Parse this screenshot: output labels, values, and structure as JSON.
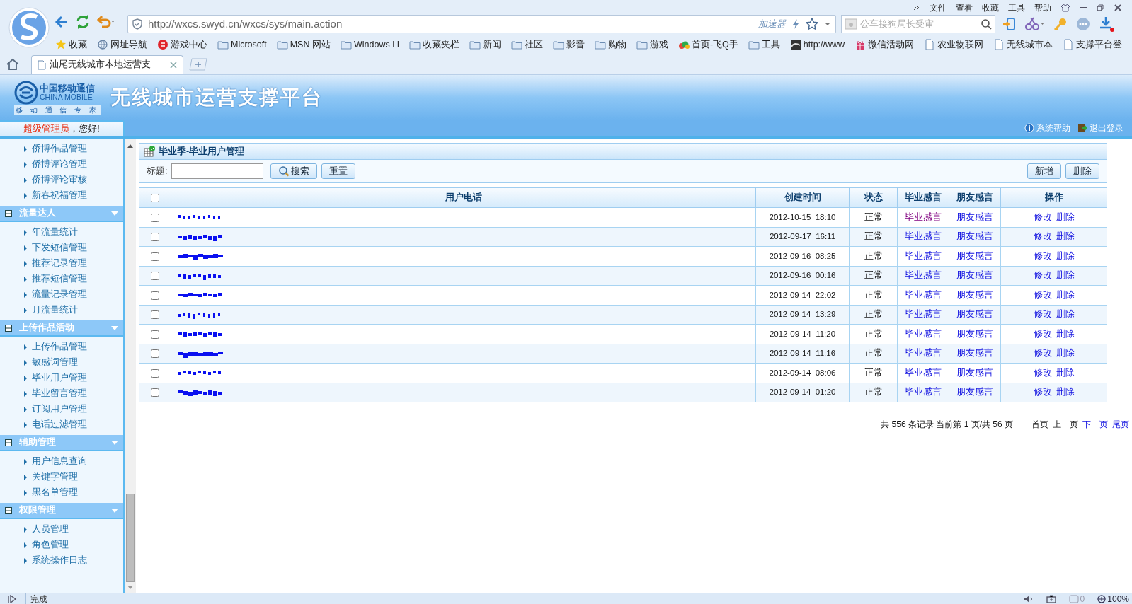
{
  "browser": {
    "menu": [
      "文件",
      "查看",
      "收藏",
      "工具",
      "帮助"
    ],
    "address": "http://wxcs.swyd.cn/wxcs/sys/main.action",
    "accelerator": "加速器",
    "search_placeholder": "公车接狗局长受审",
    "bookmarks": [
      {
        "label": "收藏",
        "kind": "star"
      },
      {
        "label": "网址导航",
        "kind": "globe"
      },
      {
        "label": "游戏中心",
        "kind": "game"
      },
      {
        "label": "Microsoft",
        "kind": "folder"
      },
      {
        "label": "MSN 网站",
        "kind": "folder"
      },
      {
        "label": "Windows Li",
        "kind": "folder"
      },
      {
        "label": "收藏夹栏",
        "kind": "folder"
      },
      {
        "label": "新闻",
        "kind": "folder"
      },
      {
        "label": "社区",
        "kind": "folder"
      },
      {
        "label": "影音",
        "kind": "folder"
      },
      {
        "label": "购物",
        "kind": "folder"
      },
      {
        "label": "游戏",
        "kind": "folder"
      },
      {
        "label": "首页-飞Q手",
        "kind": "cloud"
      },
      {
        "label": "工具",
        "kind": "folder"
      },
      {
        "label": "http://www",
        "kind": "image"
      },
      {
        "label": "微信活动网",
        "kind": "gift"
      },
      {
        "label": "农业物联网",
        "kind": "page"
      },
      {
        "label": "无线城市本",
        "kind": "page"
      },
      {
        "label": "支撑平台登",
        "kind": "page"
      }
    ],
    "tabs": [
      {
        "title": "汕尾无线城市本地运营支",
        "selected": true
      }
    ],
    "status": "完成",
    "ad_count": "0",
    "zoom": "100%"
  },
  "header": {
    "logo_cn": "中国移动通信",
    "logo_en": "CHINA MOBILE",
    "logo_tagline": "移 动 通 信 专 家",
    "title": "无线城市运营支撑平台",
    "links": [
      {
        "label": "系统帮助",
        "kind": "help"
      },
      {
        "label": "退出登录",
        "kind": "exit"
      }
    ]
  },
  "sidebar": {
    "user": "超级管理员",
    "greeting": "，您好!",
    "groups": [
      {
        "items": [
          "侨博作品管理",
          "侨博评论管理",
          "侨博评论审核",
          "新春祝福管理"
        ]
      },
      {
        "title": "流量达人",
        "expanded": true,
        "items": [
          "年流量统计",
          "下发短信管理",
          "推荐记录管理",
          "推荐短信管理",
          "流量记录管理",
          "月流量统计"
        ]
      },
      {
        "title": "上传作品活动",
        "expanded": true,
        "items": [
          "上传作品管理",
          "敏感词管理",
          "毕业用户管理",
          "毕业留言管理",
          "订阅用户管理",
          "电话过滤管理"
        ]
      },
      {
        "title": "辅助管理",
        "expanded": true,
        "items": [
          "用户信息查询",
          "关键字管理",
          "黑名单管理"
        ]
      },
      {
        "title": "权限管理",
        "expanded": true,
        "items": [
          "人员管理",
          "角色管理",
          "系统操作日志"
        ]
      }
    ]
  },
  "panel": {
    "title": "毕业季-毕业用户管理",
    "search_label": "标题:",
    "search_button": "搜索",
    "reset_button": "重置",
    "add_button": "新增",
    "delete_button": "删除"
  },
  "table": {
    "select_all_checked": false,
    "columns": [
      "用户电话",
      "创建时间",
      "状态",
      "毕业感言",
      "朋友感言",
      "操作"
    ],
    "rows": [
      {
        "checked": false,
        "created": "2012-10-15  18:10",
        "status": "正常",
        "grad": "毕业感言",
        "grad_visited": true,
        "friend": "朋友感言",
        "edit": "修改",
        "delete": "删除"
      },
      {
        "checked": false,
        "created": "2012-09-17  16:11",
        "status": "正常",
        "grad": "毕业感言",
        "grad_visited": false,
        "friend": "朋友感言",
        "edit": "修改",
        "delete": "删除"
      },
      {
        "checked": false,
        "created": "2012-09-16  08:25",
        "status": "正常",
        "grad": "毕业感言",
        "grad_visited": false,
        "friend": "朋友感言",
        "edit": "修改",
        "delete": "删除"
      },
      {
        "checked": false,
        "created": "2012-09-16  00:16",
        "status": "正常",
        "grad": "毕业感言",
        "grad_visited": false,
        "friend": "朋友感言",
        "edit": "修改",
        "delete": "删除"
      },
      {
        "checked": false,
        "created": "2012-09-14  22:02",
        "status": "正常",
        "grad": "毕业感言",
        "grad_visited": false,
        "friend": "朋友感言",
        "edit": "修改",
        "delete": "删除"
      },
      {
        "checked": false,
        "created": "2012-09-14  13:29",
        "status": "正常",
        "grad": "毕业感言",
        "grad_visited": false,
        "friend": "朋友感言",
        "edit": "修改",
        "delete": "删除"
      },
      {
        "checked": false,
        "created": "2012-09-14  11:20",
        "status": "正常",
        "grad": "毕业感言",
        "grad_visited": false,
        "friend": "朋友感言",
        "edit": "修改",
        "delete": "删除"
      },
      {
        "checked": false,
        "created": "2012-09-14  11:16",
        "status": "正常",
        "grad": "毕业感言",
        "grad_visited": false,
        "friend": "朋友感言",
        "edit": "修改",
        "delete": "删除"
      },
      {
        "checked": false,
        "created": "2012-09-14  08:06",
        "status": "正常",
        "grad": "毕业感言",
        "grad_visited": false,
        "friend": "朋友感言",
        "edit": "修改",
        "delete": "删除"
      },
      {
        "checked": false,
        "created": "2012-09-14  01:20",
        "status": "正常",
        "grad": "毕业感言",
        "grad_visited": false,
        "friend": "朋友感言",
        "edit": "修改",
        "delete": "删除"
      }
    ]
  },
  "pagination": {
    "summary": "共 556 条记录 当前第 1 页/共 56 页",
    "links": [
      {
        "label": "首页",
        "disabled": true
      },
      {
        "label": "上一页",
        "disabled": true
      },
      {
        "label": "下一页",
        "disabled": false
      },
      {
        "label": "尾页",
        "disabled": false
      }
    ]
  }
}
